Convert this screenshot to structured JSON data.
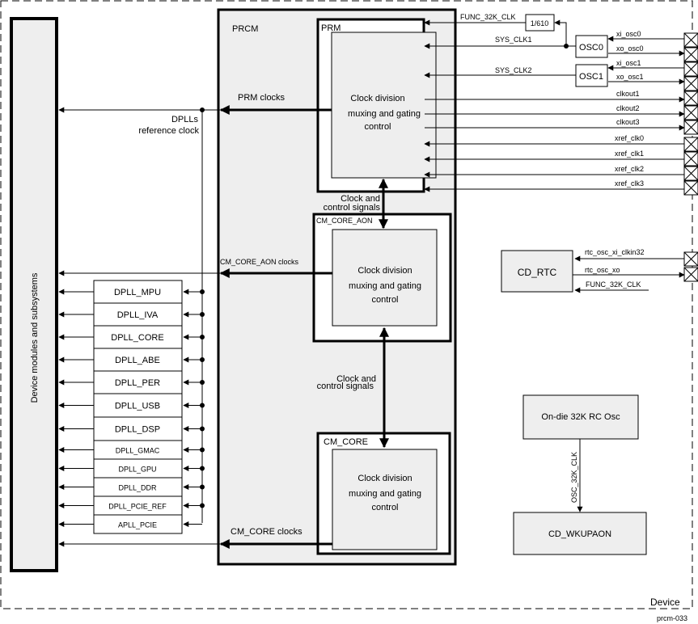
{
  "diagram": {
    "device_label": "Device",
    "figure_id": "prcm-033",
    "device_modules_label": "Device modules and subsystems",
    "prcm_label": "PRCM",
    "prm": {
      "label": "PRM",
      "inner": [
        "Clock division",
        "muxing and gating",
        "control"
      ],
      "clocks_label": "PRM clocks"
    },
    "cm_core_aon": {
      "label": "CM_CORE_AON",
      "inner": [
        "Clock division",
        "muxing and gating",
        "control"
      ],
      "clocks_label": "CM_CORE_AON clocks"
    },
    "cm_core": {
      "label": "CM_CORE",
      "inner": [
        "Clock division",
        "muxing and gating",
        "control"
      ],
      "clocks_label": "CM_CORE clocks"
    },
    "control_signals_1": [
      "Clock and",
      "control signals"
    ],
    "control_signals_2": [
      "Clock and",
      "control signals"
    ],
    "dpll_ref": [
      "DPLLs",
      "reference clock"
    ],
    "dplls": [
      "DPLL_MPU",
      "DPLL_IVA",
      "DPLL_CORE",
      "DPLL_ABE",
      "DPLL_PER",
      "DPLL_USB",
      "DPLL_DSP",
      "DPLL_GMAC",
      "DPLL_GPU",
      "DPLL_DDR",
      "DPLL_PCIE_REF",
      "APLL_PCIE"
    ],
    "divider_label": "1/610",
    "osc0_label": "OSC0",
    "osc1_label": "OSC1",
    "signals": {
      "func_32k_clk": "FUNC_32K_CLK",
      "sys_clk1": "SYS_CLK1",
      "sys_clk2": "SYS_CLK2",
      "xi_osc0": "xi_osc0",
      "xo_osc0": "xo_osc0",
      "xi_osc1": "xi_osc1",
      "xo_osc1": "xo_osc1",
      "clkouts": [
        "clkout1",
        "clkout2",
        "clkout3"
      ],
      "xref_clks": [
        "xref_clk0",
        "xref_clk1",
        "xref_clk2",
        "xref_clk3"
      ],
      "rtc_osc_xi": "rtc_osc_xi_clkin32",
      "rtc_osc_xo": "rtc_osc_xo",
      "rtc_func_32k": "FUNC_32K_CLK",
      "osc_32k_clk": "OSC_32K_CLK"
    },
    "cd_rtc_label": "CD_RTC",
    "rc_osc_label": "On-die 32K RC Osc",
    "cd_wkupaon_label": "CD_WKUPAON"
  }
}
